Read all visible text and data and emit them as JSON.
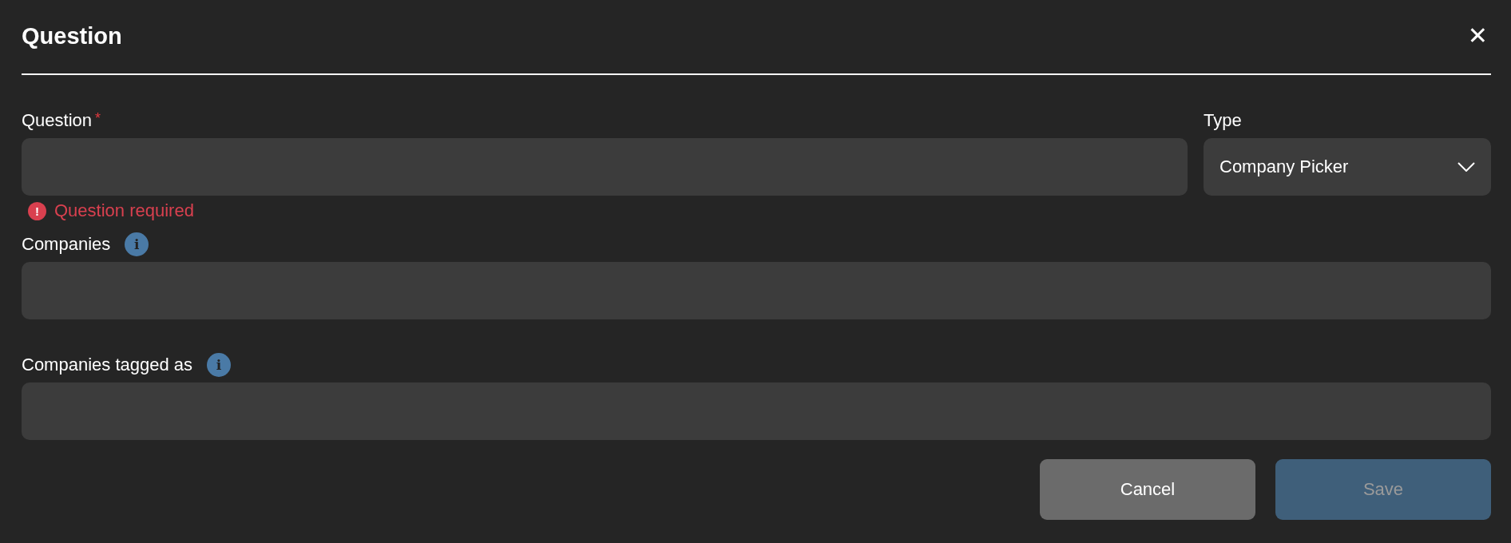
{
  "dialog": {
    "title": "Question",
    "close": "✕"
  },
  "question": {
    "label": "Question",
    "required": true,
    "required_mark": "*",
    "error": "Question required",
    "error_icon": "!"
  },
  "type": {
    "label": "Type",
    "value": "Company Picker"
  },
  "fields": [
    {
      "label": "Companies",
      "info": "i"
    },
    {
      "label": "Companies tagged as",
      "info": "i"
    }
  ],
  "buttons": [
    {
      "label": "Cancel",
      "kind": "secondary",
      "disabled": false
    },
    {
      "label": "Save",
      "kind": "primary",
      "disabled": true
    }
  ]
}
